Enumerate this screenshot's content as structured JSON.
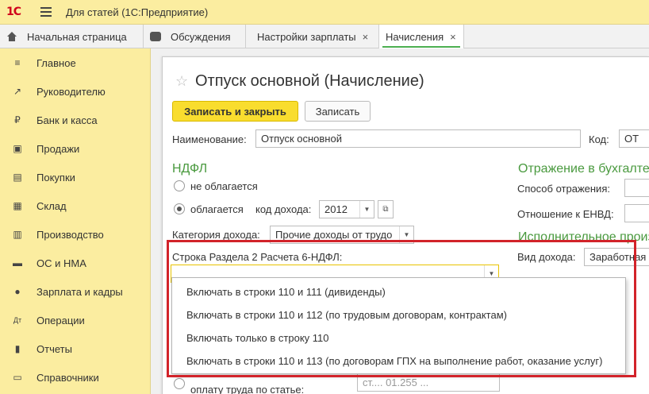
{
  "titlebar": {
    "logo": "1С",
    "title": "Для статей  (1С:Предприятие)"
  },
  "tabs": [
    {
      "label": "Начальная страница"
    },
    {
      "label": "Обсуждения"
    },
    {
      "label": "Настройки зарплаты",
      "close": "×"
    },
    {
      "label": "Начисления",
      "close": "×"
    }
  ],
  "sidebar": {
    "items": [
      {
        "label": "Главное",
        "icon": "≡"
      },
      {
        "label": "Руководителю",
        "icon": "↗"
      },
      {
        "label": "Банк и касса",
        "icon": "₽"
      },
      {
        "label": "Продажи",
        "icon": "▣"
      },
      {
        "label": "Покупки",
        "icon": "▤"
      },
      {
        "label": "Склад",
        "icon": "▦"
      },
      {
        "label": "Производство",
        "icon": "▥"
      },
      {
        "label": "ОС и НМА",
        "icon": "▬"
      },
      {
        "label": "Зарплата и кадры",
        "icon": "●"
      },
      {
        "label": "Операции",
        "icon": "Дт"
      },
      {
        "label": "Отчеты",
        "icon": "▮"
      },
      {
        "label": "Справочники",
        "icon": "▭"
      }
    ]
  },
  "form": {
    "star": "☆",
    "title": "Отпуск основной (Начисление)",
    "save_close": "Записать и закрыть",
    "save": "Записать",
    "name_label": "Наименование:",
    "name_value": "Отпуск основной",
    "code_label": "Код:",
    "code_value": "ОТ",
    "ndfl_section": "НДФЛ",
    "radio_not_taxed": "не облагается",
    "radio_taxed": "облагается",
    "income_code_label": "код дохода:",
    "income_code_value": "2012",
    "income_category_label": "Категория дохода:",
    "income_category_value": "Прочие доходы от трудо",
    "row_6ndfl_label": "Строка Раздела 2 Расчета 6-НДФЛ:",
    "row_6ndfl_value": "",
    "accounting_section": "Отражение в бухгалте",
    "reflection_method_label": "Способ отражения:",
    "envd_label": "Отношение к ЕНВД:",
    "enforcement_section": "Исполнительное произ",
    "income_type_label": "Вид дохода:",
    "income_type_value": "Заработная",
    "bottom_label": "оплату труда по статье:",
    "bottom_value": "ст.... 01.255 ..."
  },
  "dropdown": {
    "options": [
      "Включать в строки 110 и 111 (дивиденды)",
      "Включать в строки 110 и 112 (по трудовым договорам, контрактам)",
      "Включать только в строку 110",
      "Включать в строки 110 и 113 (по договорам ГПХ на выполнение работ, оказание услуг)"
    ]
  },
  "colors": {
    "accent_yellow": "#fbeda0",
    "section_green": "#4a9a3f",
    "highlight_red": "#d2232a",
    "primary_button": "#f9dd2e"
  }
}
